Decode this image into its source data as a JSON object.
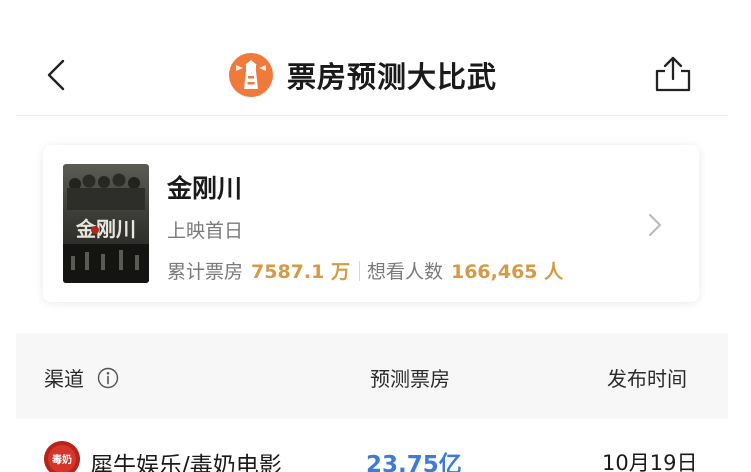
{
  "header": {
    "title": "票房预测大比武",
    "back_icon": "chevron-left-icon",
    "share_icon": "share-upload-icon",
    "logo_icon": "lighthouse-icon",
    "accent_color": "#ef7a3c"
  },
  "movie": {
    "title": "金刚川",
    "status": "上映首日",
    "box_office_label": "累计票房",
    "box_office_value": "7587.1 万",
    "want_label": "想看人数",
    "want_value": "166,465 人",
    "highlight_color": "#d49a45",
    "poster_text": "金刚川"
  },
  "table": {
    "columns": [
      "渠道",
      "预测票房",
      "发布时间"
    ],
    "info_icon": "info-circle-icon",
    "rows": [
      {
        "channel": "犀牛娱乐/毒奶电影",
        "forecast": "23.75亿",
        "date": "10月19日",
        "logo_text": "毒奶"
      }
    ],
    "forecast_color": "#3d7bd6"
  }
}
